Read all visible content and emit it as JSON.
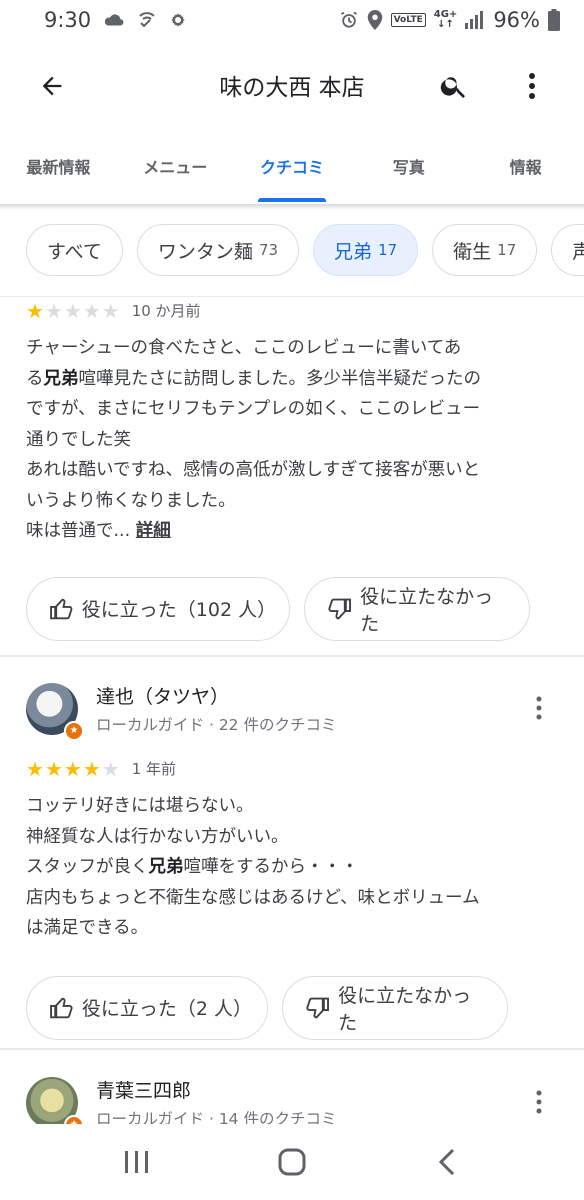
{
  "status_bar": {
    "time": "9:30",
    "battery": "96%",
    "network_label": "4G+",
    "lte_label": "VoLTE"
  },
  "app_bar": {
    "title": "味の大西 本店"
  },
  "tabs": [
    {
      "label": "最新情報",
      "active": false
    },
    {
      "label": "メニュー",
      "active": false
    },
    {
      "label": "クチコミ",
      "active": true
    },
    {
      "label": "写真",
      "active": false
    },
    {
      "label": "情報",
      "active": false
    }
  ],
  "filter_chips": [
    {
      "label": "すべて",
      "count": ""
    },
    {
      "label": "ワンタン麺",
      "count": "73"
    },
    {
      "label": "兄弟",
      "count": "17",
      "selected": true
    },
    {
      "label": "衛生",
      "count": "17"
    },
    {
      "label": "声",
      "count": ""
    }
  ],
  "reviews": [
    {
      "rating": 1,
      "date": "10 か月前",
      "text_lines": [
        "チャーシューの食べたさと、ここのレビューに書いてあ",
        "る|兄弟|喧嘩見たさに訪問しました。多少半信半疑だったの",
        "ですが、まさにセリフもテンプレの如く、ここのレビュー",
        "通りでした笑",
        "あれは酷いですね、感情の高低が激しすぎて接客が悪いと",
        "いうより怖くなりました。",
        "味は普通で..."
      ],
      "more_label": "詳細",
      "helpful_label": "役に立った（102 人）",
      "not_helpful_label": "役に立たなかった"
    },
    {
      "reviewer_name": "達也（タツヤ）",
      "reviewer_sub": "ローカルガイド · 22 件のクチコミ",
      "rating": 4,
      "date": "1 年前",
      "text_lines": [
        "コッテリ好きには堪らない。",
        "神経質な人は行かない方がいい。",
        "スタッフが良く|兄弟|喧嘩をするから・・・",
        "店内もちょっと不衛生な感じはあるけど、味とボリューム",
        "は満足できる。"
      ],
      "helpful_label": "役に立った（2 人）",
      "not_helpful_label": "役に立たなかった"
    },
    {
      "reviewer_name": "青葉三四郎",
      "reviewer_sub": "ローカルガイド · 14 件のクチコミ"
    }
  ],
  "colors": {
    "accent": "#1a73e8",
    "star": "#fbbc04",
    "badge": "#e8710a"
  }
}
